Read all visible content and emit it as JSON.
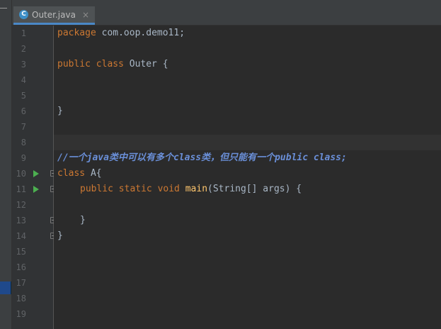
{
  "tab": {
    "icon_letter": "C",
    "label": "Outer.java",
    "close": "×"
  },
  "line_numbers": [
    "1",
    "2",
    "3",
    "4",
    "5",
    "6",
    "7",
    "8",
    "9",
    "10",
    "11",
    "12",
    "13",
    "14",
    "15",
    "16",
    "17",
    "18",
    "19"
  ],
  "code": {
    "l1_kw": "package",
    "l1_rest": " com.oop.demo11;",
    "l3_kw": "public class",
    "l3_rest": " Outer {",
    "l6": "}",
    "l9": "//一个java类中可以有多个class类，但只能有一个public class;",
    "l10_kw": "class",
    "l10_rest": " A{",
    "l11_kw": "public static void",
    "l11_fn": "main",
    "l11_rest": "(String[] args) {",
    "l13": "}",
    "l14": "}"
  },
  "gutter_icons": {
    "run": "run-icon",
    "fold": "fold-icon"
  },
  "colors": {
    "keyword": "#cc7832",
    "method": "#ffc66d",
    "comment": "#6a8fd8",
    "text": "#a9b7c6",
    "run": "#4caf50"
  }
}
